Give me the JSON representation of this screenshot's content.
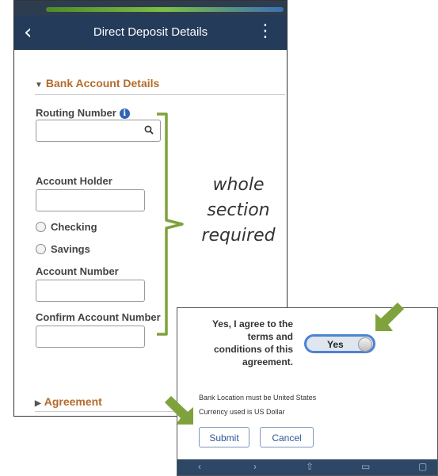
{
  "navbar": {
    "back_icon": "chevron-left-icon",
    "title": "Direct Deposit Details",
    "more_icon": "vertical-ellipsis-icon"
  },
  "bank_section": {
    "header": "Bank Account Details",
    "routing_label": "Routing Number",
    "routing_value": "",
    "account_holder_label": "Account Holder",
    "account_holder_value": "",
    "radio_options": [
      "Checking",
      "Savings"
    ],
    "account_number_label": "Account Number",
    "account_number_value": "",
    "confirm_account_label": "Confirm Account Number",
    "confirm_account_value": ""
  },
  "agreement_section": {
    "header": "Agreement"
  },
  "annotation": {
    "lines": [
      "whole",
      "section",
      "required"
    ],
    "bracket_color": "#7fa23c",
    "arrow_color": "#7fa23c"
  },
  "popup": {
    "agree_lines": [
      "Yes, I agree to the",
      "terms and",
      "conditions of this",
      "agreement."
    ],
    "toggle_label": "Yes",
    "toggle_on": true,
    "note_location": "Bank Location must be United States",
    "note_currency": "Currency used is US Dollar",
    "submit_label": "Submit",
    "cancel_label": "Cancel"
  },
  "colors": {
    "navbar": "#243b5a",
    "section_header": "#b46b2a",
    "button_text": "#2a5697"
  }
}
